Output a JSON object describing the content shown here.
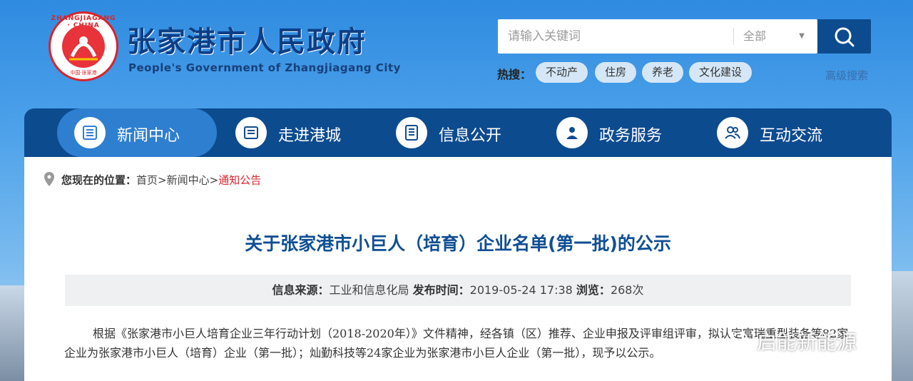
{
  "header": {
    "logo_ring_text": "ZHANGJIAGANG · CHINA",
    "logo_bottom_text": "中国·张家港",
    "title": "张家港市人民政府",
    "subtitle": "People's Government of Zhangjiagang City"
  },
  "search": {
    "placeholder": "请输入关键词",
    "scope": "全部",
    "hot_label": "热搜：",
    "hot_tags": [
      "不动产",
      "住房",
      "养老",
      "文化建设"
    ],
    "advanced": "高级搜索"
  },
  "nav": {
    "items": [
      {
        "label": "新闻中心",
        "icon": "newspaper-icon"
      },
      {
        "label": "走进港城",
        "icon": "list-icon"
      },
      {
        "label": "信息公开",
        "icon": "document-icon"
      },
      {
        "label": "政务服务",
        "icon": "user-service-icon"
      },
      {
        "label": "互动交流",
        "icon": "people-icon"
      }
    ],
    "active_index": 0
  },
  "breadcrumb": {
    "label": "您现在的位置：",
    "home": "首页",
    "sep1": ">",
    "section": "新闻中心",
    "sep2": ">",
    "current": "通知公告"
  },
  "article": {
    "title": "关于张家港市小巨人（培育）企业名单(第一批)的公示",
    "source_label": "信息来源：",
    "source": "工业和信息化局",
    "time_label": "发布时间：",
    "time": "2019-05-24 17:38",
    "views_label": "浏览：",
    "views": "268次",
    "body": "根据《张家港市小巨人培育企业三年行动计划（2018-2020年）》文件精神，经各镇（区）推荐、企业申报及评审组评审，拟认定富瑞重型装备等82家企业为张家港市小巨人（培育）企业（第一批）；灿勤科技等24家企业为张家港市小巨人企业（第一批），现予以公示。"
  },
  "watermark": "启能新能源",
  "colors": {
    "nav_bg": "#0d4b8f",
    "nav_active": "#2f7fd0",
    "title_blue": "#0f4f94",
    "breadcrumb_current": "#d8242c"
  }
}
